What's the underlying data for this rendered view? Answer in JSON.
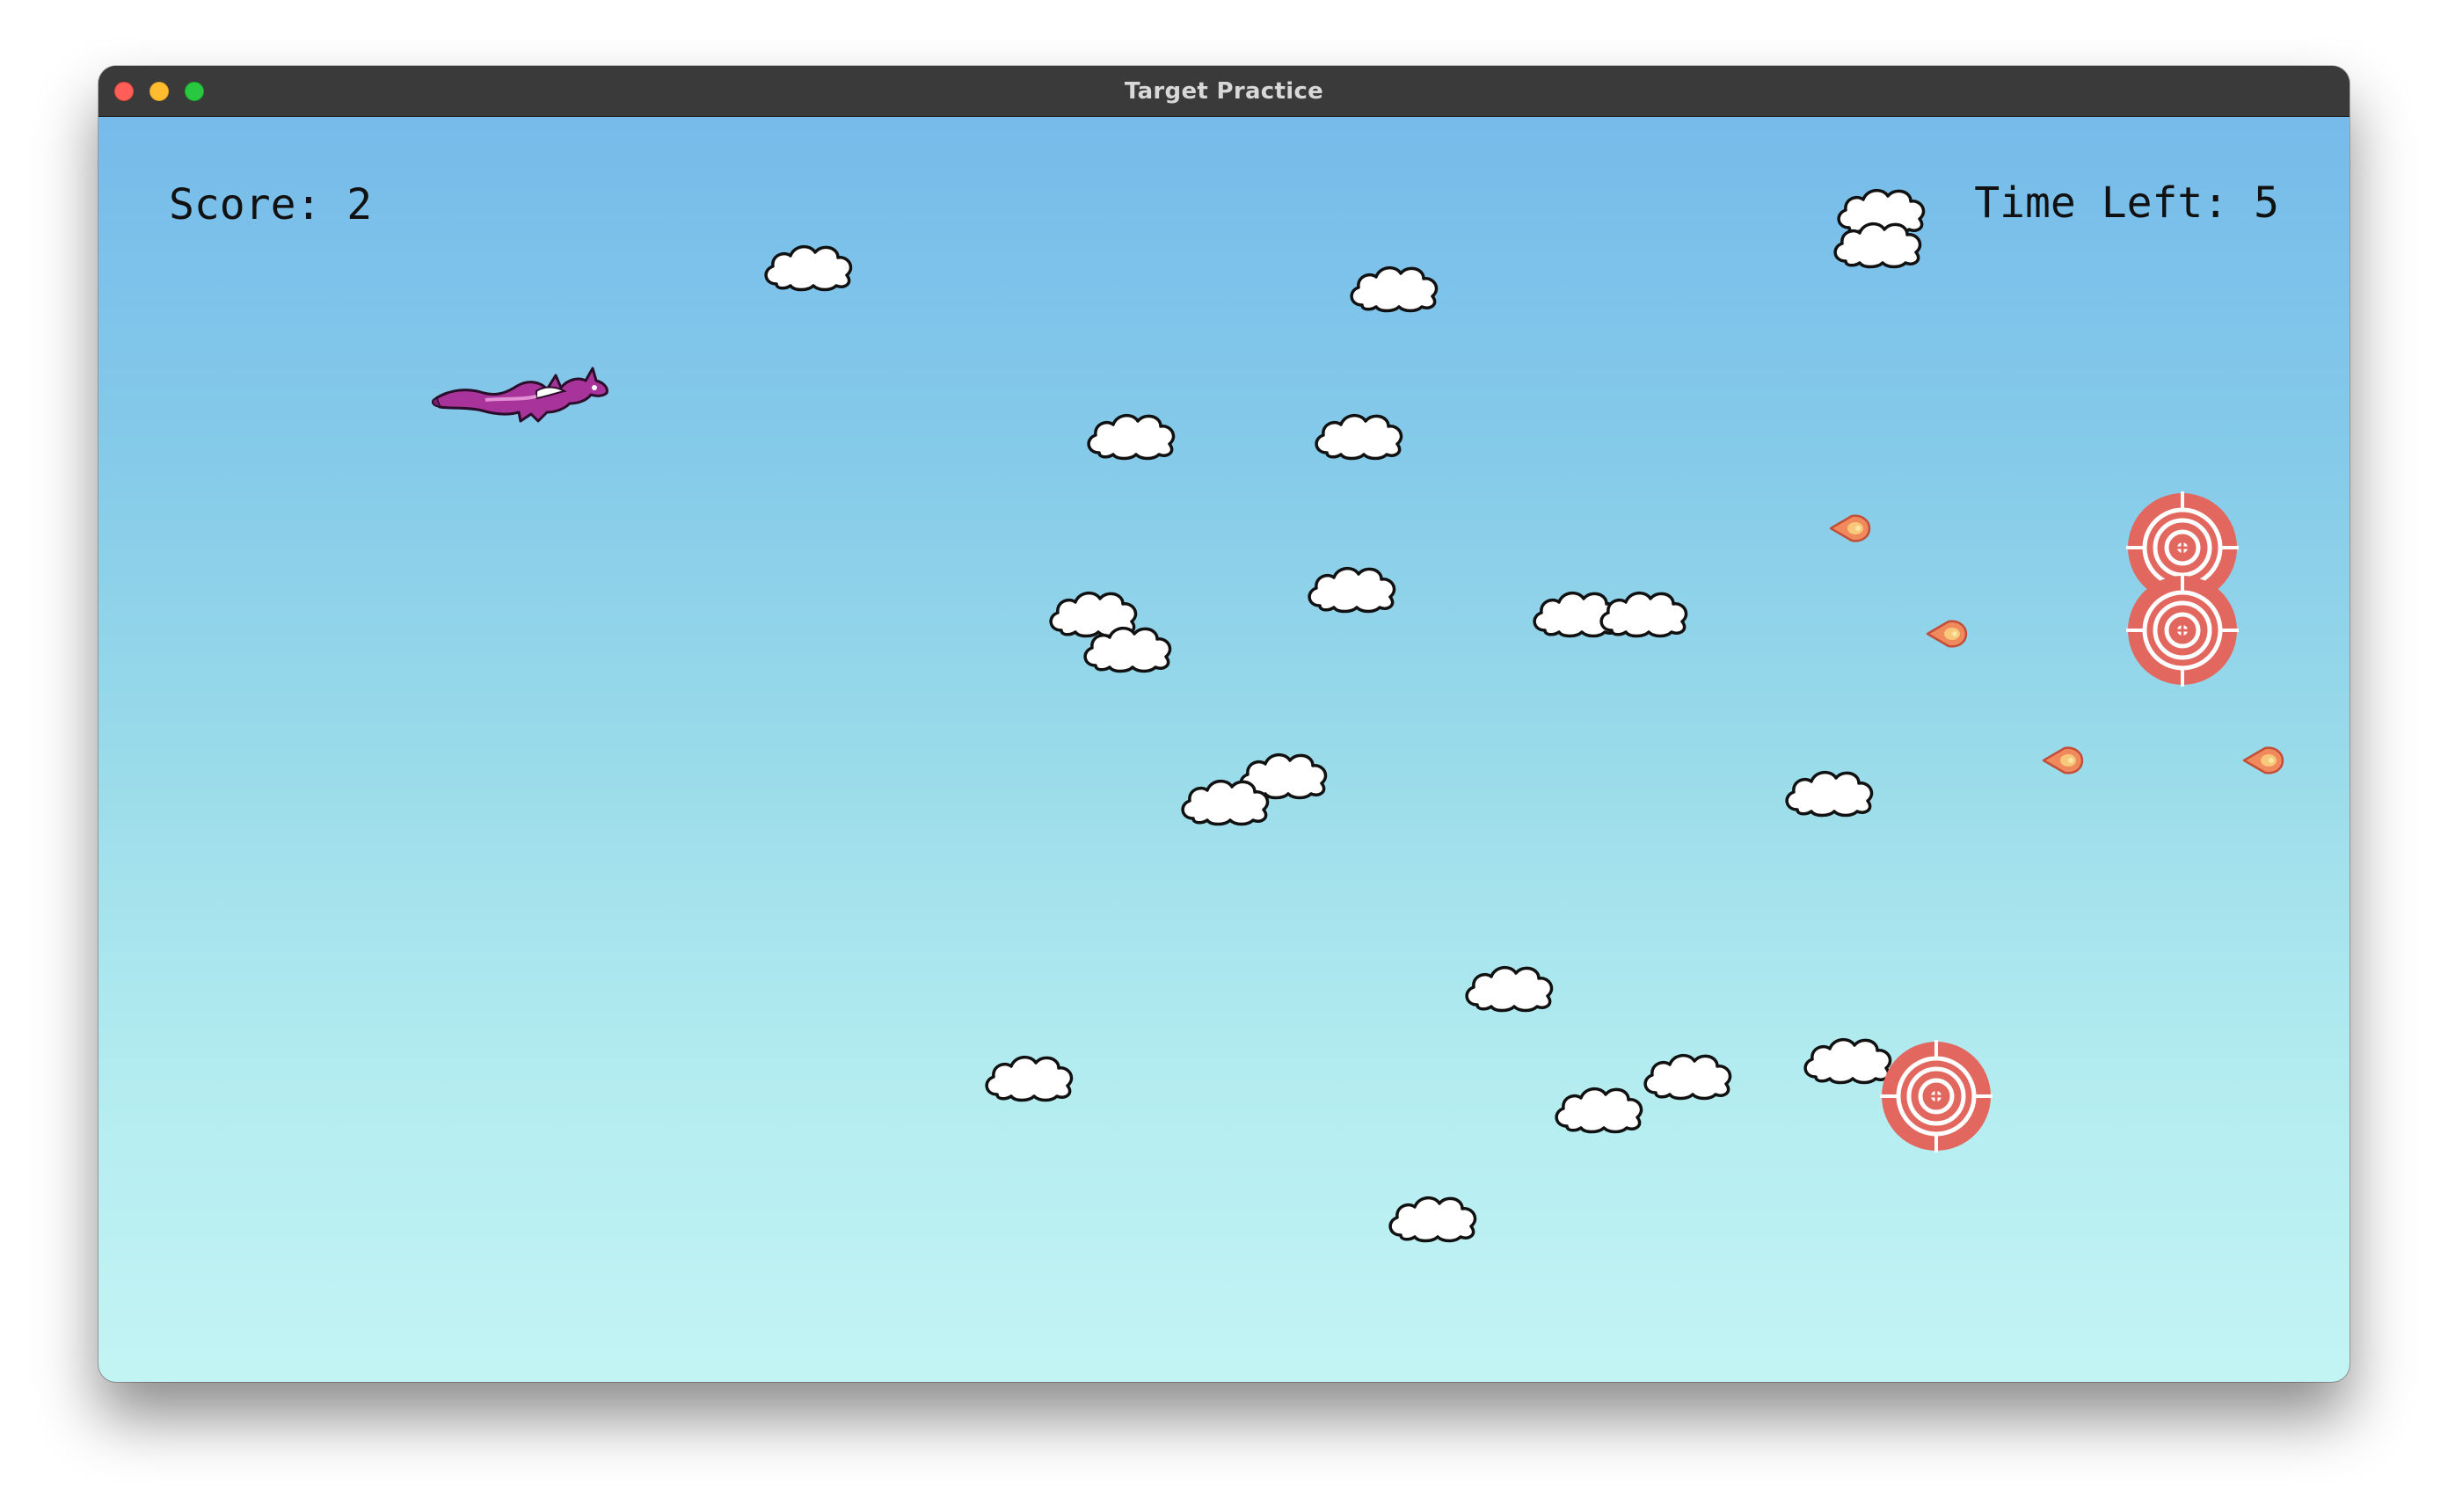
{
  "window": {
    "title": "Target Practice",
    "controls": [
      "close",
      "minimize",
      "maximize"
    ]
  },
  "hud": {
    "score_text": "Score: 2",
    "time_text": "Time Left: 5"
  },
  "colors": {
    "sky_top": "#76bbea",
    "sky_bottom": "#c3f4f4",
    "target_red": "#e2675e",
    "fireball": "#f08a5d",
    "dragon": "#a8339a"
  },
  "sprites": {
    "player": "purple-dragon",
    "cloud_count": 22,
    "target_count": 3,
    "fireball_count": 4
  }
}
